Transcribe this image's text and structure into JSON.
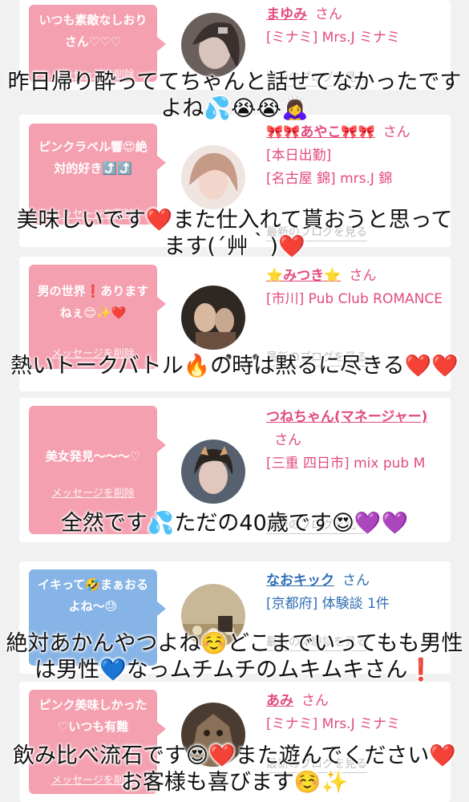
{
  "colors": {
    "accent_pink": "#e34b7c",
    "bubble_pink": "#f4a0b0",
    "bubble_blue": "#86b4e6",
    "link_blue": "#2f6eb4"
  },
  "common": {
    "delete_label": "メッセージを削除",
    "honorific": "さん",
    "blog_link": "最新のブログを見る",
    "review_link": "最新の体験談を見る"
  },
  "cards": [
    {
      "message": "いつも素敵なしおりさん♡♡♡",
      "name": "まゆみ",
      "shop": "[ミナミ] Mrs.J ミナミ",
      "bubble_color": "pink",
      "avatar_icon": "user-photo-avatar"
    },
    {
      "message": "ピンクラベル響😍絶対的好き⤴️⤴️",
      "name": "🎀🎀あやこ🎀🎀",
      "shop": "[本日出勤]\n[名古屋 錦] mrs.J 錦",
      "bubble_color": "pink",
      "avatar_icon": "user-photo-avatar"
    },
    {
      "message": "男の世界❗️ありますねぇ😊✨❤️",
      "name": "⭐️みつき⭐️",
      "shop": "[市川] Pub Club ROMANCE",
      "bubble_color": "pink",
      "avatar_icon": "user-photo-avatar"
    },
    {
      "message": "美女発見〜〜〜♡",
      "name": "つねちゃん(マネージャー)",
      "shop": "[三重 四日市] mix pub M",
      "bubble_color": "pink",
      "avatar_icon": "user-photo-avatar"
    },
    {
      "message": "イキって🤣まぁおるよね〜😓",
      "name": "なおキック",
      "shop": "[京都府] 体験談 1件",
      "bubble_color": "blue",
      "avatar_icon": "user-photo-avatar"
    },
    {
      "message": "ピンク美味しかった♡いつも有難",
      "name": "あみ",
      "shop": "[ミナミ] Mrs.J ミナミ",
      "bubble_color": "pink",
      "avatar_icon": "user-photo-avatar"
    }
  ],
  "overlays": [
    "昨日帰り酔っててちゃんと話せてなかったですよね💦😭😭🙇‍♀️",
    "美味しいです❤️また仕入れて貰おうと思ってます(´艸｀)❤️",
    "熱いトークバトル🔥の時は黙るに尽きる❤️❤️",
    "全然です💦ただの40歳です😍💜💜",
    "絶対あかんやつよね☺️どこまでいってもも男性は男性💙なっムチムチのムキムキさん❗️",
    "飲み比べ流石です😍❤️また遊んでください❤️お客様も喜びます☺️✨"
  ]
}
